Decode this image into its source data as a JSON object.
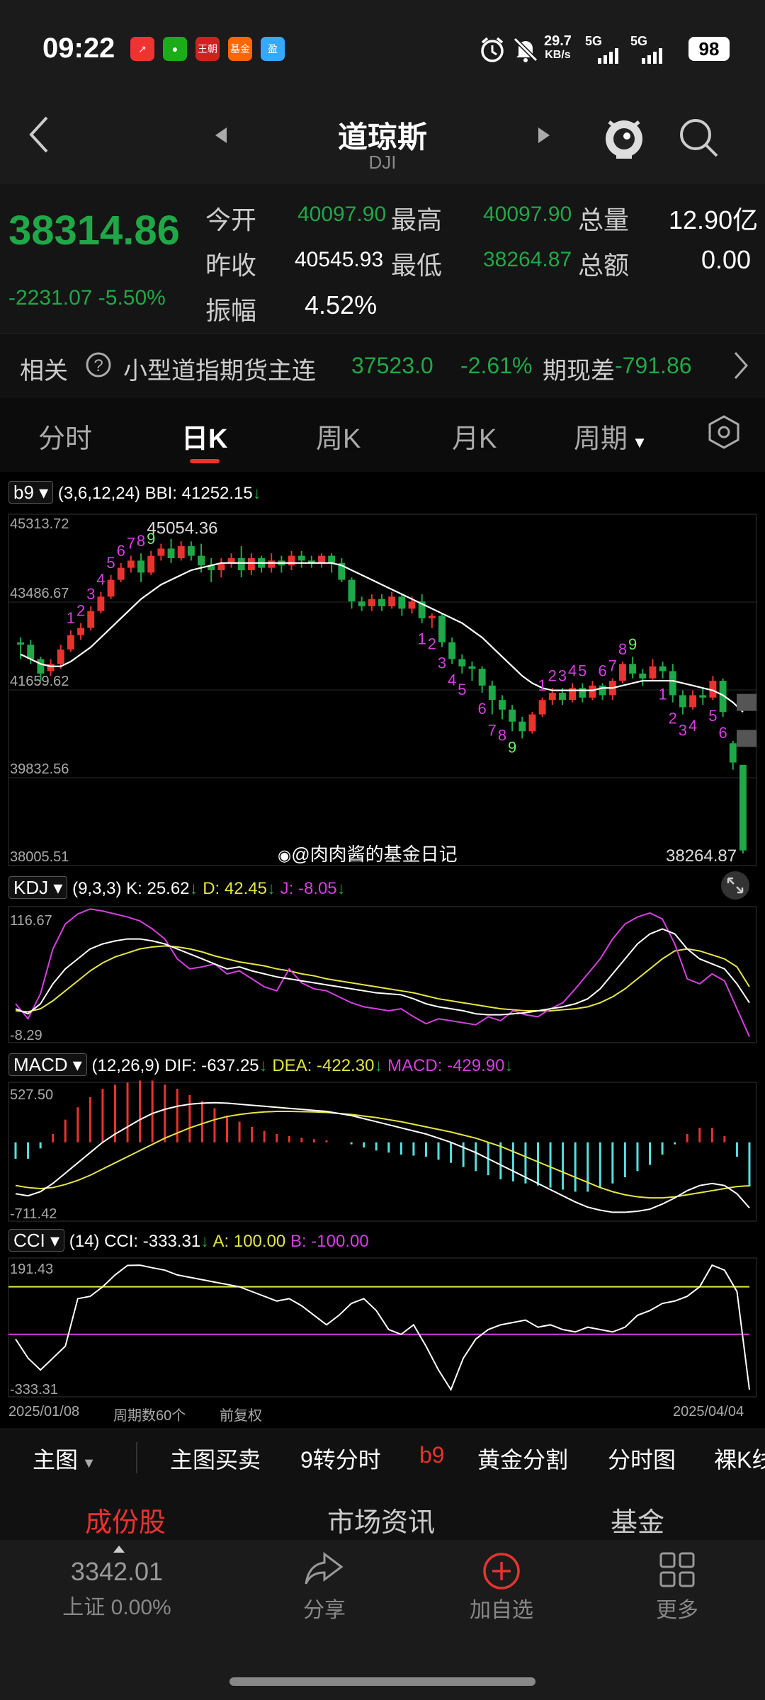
{
  "status_bar": {
    "time": "09:22",
    "net_speed": "29.7",
    "net_unit": "KB/s",
    "sig1": "5G",
    "sig2": "5G",
    "battery": "98",
    "apps": [
      {
        "name": "stock-app-icon",
        "label": "↗",
        "color": "#e33"
      },
      {
        "name": "wechat-icon",
        "label": "●",
        "color": "#1aad19"
      },
      {
        "name": "wangchao-icon",
        "label": "王朝",
        "color": "#c22"
      },
      {
        "name": "fund-app-icon",
        "label": "基金",
        "color": "#f60"
      },
      {
        "name": "eastmoney-icon",
        "label": "盈",
        "color": "#3af"
      }
    ]
  },
  "header": {
    "title": "道琼斯",
    "subtitle": "DJI"
  },
  "quote": {
    "price": "38314.86",
    "change": "-2231.07",
    "change_pct": "-5.50%",
    "open_label": "今开",
    "open": "40097.90",
    "high_label": "最高",
    "high": "40097.90",
    "vol_label": "总量",
    "vol": "12.90亿",
    "prev_label": "昨收",
    "prev": "40545.93",
    "low_label": "最低",
    "low": "38264.87",
    "amt_label": "总额",
    "amt": "0.00",
    "amp_label": "振幅",
    "amp": "4.52%"
  },
  "related": {
    "label": "相关",
    "name": "小型道指期货主连",
    "price": "37523.0",
    "pct": "-2.61%",
    "diff_label": "期现差",
    "diff": "-791.86"
  },
  "tabs": [
    "分时",
    "日K",
    "周K",
    "月K",
    "周期"
  ],
  "active_tab": 1,
  "main_chart": {
    "indicator": "b9",
    "params": "(3,6,12,24)",
    "bbi": "BBI: 41252.15",
    "arrow": "↓",
    "y_labels": [
      "45313.72",
      "43486.67",
      "41659.62",
      "39832.56",
      "38005.51"
    ],
    "high_label": "45054.36",
    "low_label": "38264.87",
    "watermark": "@肉肉酱的基金日记"
  },
  "kdj": {
    "name": "KDJ",
    "params": "(9,3,3)",
    "k": "K: 25.62",
    "d": "D: 42.45",
    "j": "J: -8.05",
    "top": "116.67",
    "bottom": "-8.29"
  },
  "macd": {
    "name": "MACD",
    "params": "(12,26,9)",
    "dif": "DIF: -637.25",
    "dea": "DEA: -422.30",
    "macd": "MACD: -429.90",
    "top": "527.50",
    "bottom": "-711.42"
  },
  "cci": {
    "name": "CCI",
    "params": "(14)",
    "cci": "CCI: -333.31",
    "a": "A: 100.00",
    "b": "B: -100.00",
    "top": "191.43",
    "bottom": "-333.31"
  },
  "footer_axis": {
    "start": "2025/01/08",
    "count": "周期数60个",
    "adj": "前复权",
    "end": "2025/04/04"
  },
  "toolbar": [
    "主图",
    "主图买卖",
    "9转分时",
    "b9",
    "黄金分割",
    "分时图",
    "裸K线"
  ],
  "sections": [
    "成份股",
    "市场资讯",
    "基金"
  ],
  "bottom_nav": {
    "index_value": "3342.01",
    "index_label": "上证 0.00%",
    "share": "分享",
    "add": "加自选",
    "more": "更多"
  },
  "colors": {
    "up": "#e8332f",
    "down": "#1fa847",
    "kdj_k": "#ffffff",
    "kdj_d": "#e5e545",
    "kdj_j": "#d63fe0"
  },
  "chart_data": {
    "type": "candlestick",
    "x_range": [
      "2025/01/08",
      "2025/04/04"
    ],
    "ylim": [
      38005.51,
      45313.72
    ],
    "candles": [
      [
        42650,
        42600,
        42300,
        42750
      ],
      [
        42600,
        42300,
        42200,
        42700
      ],
      [
        42300,
        42000,
        41850,
        42350
      ],
      [
        42050,
        42200,
        41950,
        42300
      ],
      [
        42200,
        42500,
        42100,
        42600
      ],
      [
        42500,
        42800,
        42450,
        42900
      ],
      [
        42800,
        42950,
        42700,
        43050
      ],
      [
        42950,
        43300,
        42900,
        43400
      ],
      [
        43300,
        43600,
        43250,
        43700
      ],
      [
        43600,
        43950,
        43550,
        44050
      ],
      [
        43950,
        44200,
        43900,
        44300
      ],
      [
        44200,
        44350,
        44100,
        44450
      ],
      [
        44350,
        44100,
        43900,
        44500
      ],
      [
        44100,
        44450,
        44050,
        44550
      ],
      [
        44450,
        44600,
        44350,
        44700
      ],
      [
        44600,
        44400,
        44300,
        44800
      ],
      [
        44400,
        44650,
        44350,
        44750
      ],
      [
        44650,
        44450,
        44350,
        44750
      ],
      [
        44450,
        44250,
        44100,
        44700
      ],
      [
        44250,
        44150,
        43900,
        44400
      ],
      [
        44150,
        44300,
        44000,
        44400
      ],
      [
        44300,
        44400,
        44200,
        44500
      ],
      [
        44400,
        44150,
        44000,
        44650
      ],
      [
        44150,
        44400,
        44050,
        44500
      ],
      [
        44400,
        44200,
        44100,
        44450
      ],
      [
        44200,
        44350,
        44100,
        44500
      ],
      [
        44350,
        44250,
        44100,
        44450
      ],
      [
        44250,
        44450,
        44150,
        44550
      ],
      [
        44450,
        44350,
        44200,
        44550
      ],
      [
        44350,
        44300,
        44200,
        44450
      ],
      [
        44300,
        44450,
        44200,
        44500
      ],
      [
        44450,
        44300,
        44100,
        44500
      ],
      [
        44300,
        43950,
        43900,
        44400
      ],
      [
        43950,
        43500,
        43350,
        44000
      ],
      [
        43500,
        43400,
        43300,
        43600
      ],
      [
        43400,
        43550,
        43300,
        43650
      ],
      [
        43550,
        43400,
        43300,
        43650
      ],
      [
        43400,
        43600,
        43350,
        43700
      ],
      [
        43600,
        43350,
        43200,
        43650
      ],
      [
        43350,
        43500,
        43250,
        43600
      ],
      [
        43500,
        43150,
        43050,
        43650
      ],
      [
        43150,
        43200,
        42950,
        43250
      ],
      [
        43200,
        42650,
        42550,
        43250
      ],
      [
        42650,
        42300,
        42200,
        42750
      ],
      [
        42300,
        42150,
        42000,
        42400
      ],
      [
        42150,
        42100,
        41850,
        42250
      ],
      [
        42100,
        41750,
        41600,
        42150
      ],
      [
        41750,
        41450,
        41150,
        41850
      ],
      [
        41450,
        41250,
        41050,
        41550
      ],
      [
        41250,
        41000,
        40800,
        41350
      ],
      [
        41000,
        40800,
        40650,
        41100
      ],
      [
        40800,
        41150,
        40750,
        41200
      ],
      [
        41150,
        41450,
        41100,
        41500
      ],
      [
        41450,
        41600,
        41350,
        41700
      ],
      [
        41600,
        41450,
        41350,
        41700
      ],
      [
        41450,
        41700,
        41400,
        41800
      ],
      [
        41700,
        41500,
        41400,
        41800
      ],
      [
        41500,
        41750,
        41450,
        41850
      ],
      [
        41750,
        41550,
        41450,
        41800
      ],
      [
        41550,
        41850,
        41450,
        41900
      ],
      [
        41850,
        42200,
        41800,
        42250
      ],
      [
        42200,
        42000,
        41900,
        42350
      ],
      [
        42000,
        41900,
        41750,
        42100
      ],
      [
        41900,
        42150,
        41850,
        42300
      ],
      [
        42150,
        42050,
        41900,
        42250
      ],
      [
        42050,
        41550,
        41400,
        42200
      ],
      [
        41550,
        41300,
        41150,
        41650
      ],
      [
        41300,
        41550,
        41250,
        41650
      ],
      [
        41550,
        41500,
        41350,
        41700
      ],
      [
        41500,
        41850,
        41450,
        41950
      ],
      [
        41850,
        41200,
        41100,
        41900
      ],
      [
        40550,
        40150,
        40000,
        40600
      ],
      [
        40100,
        38320,
        38260,
        40100
      ]
    ],
    "bbi_line": [
      42400,
      42300,
      42200,
      42150,
      42150,
      42250,
      42400,
      42550,
      42750,
      42950,
      43150,
      43350,
      43550,
      43700,
      43850,
      43950,
      44050,
      44150,
      44200,
      44250,
      44300,
      44300,
      44300,
      44300,
      44300,
      44300,
      44300,
      44300,
      44300,
      44300,
      44300,
      44300,
      44250,
      44150,
      44050,
      43950,
      43850,
      43750,
      43650,
      43550,
      43450,
      43350,
      43250,
      43150,
      43050,
      42900,
      42750,
      42550,
      42350,
      42150,
      41950,
      41800,
      41700,
      41650,
      41650,
      41650,
      41650,
      41650,
      41700,
      41700,
      41750,
      41800,
      41850,
      41850,
      41850,
      41850,
      41800,
      41750,
      41700,
      41650,
      41550,
      41400,
      41200
    ],
    "b9_marks": [
      {
        "label": "1",
        "i": 5,
        "pos": "up"
      },
      {
        "label": "2",
        "i": 6,
        "pos": "up"
      },
      {
        "label": "3",
        "i": 7,
        "pos": "up"
      },
      {
        "label": "4",
        "i": 8,
        "pos": "up"
      },
      {
        "label": "5",
        "i": 9,
        "pos": "up"
      },
      {
        "label": "6",
        "i": 10,
        "pos": "up"
      },
      {
        "label": "7",
        "i": 11,
        "pos": "up"
      },
      {
        "label": "8",
        "i": 12,
        "pos": "up"
      },
      {
        "label": "9",
        "i": 13,
        "pos": "up",
        "green": true
      },
      {
        "label": "1",
        "i": 40,
        "pos": "down"
      },
      {
        "label": "2",
        "i": 41,
        "pos": "down"
      },
      {
        "label": "3",
        "i": 42,
        "pos": "down"
      },
      {
        "label": "4",
        "i": 43,
        "pos": "down"
      },
      {
        "label": "5",
        "i": 44,
        "pos": "down"
      },
      {
        "label": "6",
        "i": 46,
        "pos": "down"
      },
      {
        "label": "7",
        "i": 47,
        "pos": "down"
      },
      {
        "label": "8",
        "i": 48,
        "pos": "down"
      },
      {
        "label": "9",
        "i": 49,
        "pos": "down",
        "green": true
      },
      {
        "label": "1",
        "i": 52,
        "pos": "up"
      },
      {
        "label": "2",
        "i": 53,
        "pos": "up"
      },
      {
        "label": "3",
        "i": 54,
        "pos": "up"
      },
      {
        "label": "4",
        "i": 55,
        "pos": "up"
      },
      {
        "label": "5",
        "i": 56,
        "pos": "up"
      },
      {
        "label": "6",
        "i": 58,
        "pos": "up"
      },
      {
        "label": "7",
        "i": 59,
        "pos": "up"
      },
      {
        "label": "8",
        "i": 60,
        "pos": "up"
      },
      {
        "label": "9",
        "i": 61,
        "pos": "up",
        "green": true
      },
      {
        "label": "1",
        "i": 64,
        "pos": "down"
      },
      {
        "label": "2",
        "i": 65,
        "pos": "down"
      },
      {
        "label": "3",
        "i": 66,
        "pos": "down"
      },
      {
        "label": "4",
        "i": 67,
        "pos": "down"
      },
      {
        "label": "5",
        "i": 69,
        "pos": "down"
      },
      {
        "label": "6",
        "i": 70,
        "pos": "down"
      }
    ],
    "kdj_k": [
      20,
      15,
      25,
      45,
      60,
      70,
      80,
      85,
      88,
      90,
      90,
      88,
      85,
      80,
      75,
      70,
      65,
      60,
      62,
      58,
      55,
      52,
      50,
      48,
      46,
      44,
      42,
      40,
      38,
      36,
      35,
      34,
      30,
      25,
      22,
      20,
      18,
      15,
      14,
      14,
      15,
      16,
      18,
      20,
      22,
      25,
      30,
      40,
      55,
      70,
      85,
      95,
      100,
      95,
      80,
      70,
      65,
      60,
      45,
      26
    ],
    "kdj_d": [
      18,
      17,
      20,
      28,
      38,
      48,
      58,
      66,
      72,
      76,
      80,
      82,
      83,
      82,
      80,
      77,
      73,
      70,
      67,
      65,
      63,
      60,
      58,
      55,
      53,
      50,
      48,
      46,
      44,
      42,
      40,
      38,
      36,
      33,
      30,
      28,
      26,
      24,
      22,
      20,
      19,
      18,
      18,
      18,
      19,
      20,
      22,
      26,
      32,
      40,
      50,
      60,
      70,
      78,
      80,
      78,
      74,
      70,
      62,
      42
    ],
    "kdj_j": [
      25,
      10,
      35,
      80,
      105,
      115,
      120,
      118,
      115,
      112,
      108,
      100,
      90,
      70,
      60,
      62,
      65,
      55,
      58,
      50,
      42,
      38,
      60,
      46,
      40,
      38,
      32,
      26,
      22,
      20,
      18,
      20,
      12,
      5,
      10,
      8,
      6,
      4,
      12,
      8,
      18,
      14,
      12,
      20,
      26,
      40,
      55,
      70,
      90,
      105,
      112,
      116,
      110,
      85,
      50,
      45,
      55,
      48,
      20,
      -8
    ],
    "macd_dif": [
      -500,
      -520,
      -480,
      -400,
      -300,
      -200,
      -100,
      0,
      80,
      150,
      220,
      280,
      320,
      350,
      370,
      380,
      385,
      380,
      370,
      360,
      350,
      340,
      330,
      320,
      310,
      300,
      280,
      260,
      230,
      200,
      170,
      140,
      110,
      80,
      40,
      0,
      -50,
      -100,
      -160,
      -220,
      -280,
      -340,
      -400,
      -460,
      -520,
      -580,
      -630,
      -660,
      -680,
      -680,
      -670,
      -650,
      -600,
      -540,
      -470,
      -420,
      -400,
      -420,
      -500,
      -637
    ],
    "macd_dea": [
      -420,
      -440,
      -450,
      -440,
      -410,
      -370,
      -320,
      -260,
      -200,
      -140,
      -80,
      -20,
      40,
      90,
      140,
      180,
      220,
      250,
      270,
      285,
      295,
      300,
      300,
      298,
      295,
      290,
      280,
      270,
      255,
      240,
      220,
      200,
      175,
      150,
      125,
      100,
      70,
      40,
      0,
      -40,
      -90,
      -140,
      -190,
      -240,
      -290,
      -340,
      -390,
      -440,
      -480,
      -510,
      -530,
      -540,
      -540,
      -530,
      -510,
      -490,
      -470,
      -450,
      -430,
      -422
    ],
    "cci": [
      -120,
      -200,
      -250,
      -200,
      -150,
      50,
      60,
      100,
      150,
      190,
      191,
      180,
      170,
      150,
      140,
      130,
      120,
      110,
      100,
      80,
      60,
      40,
      50,
      20,
      -20,
      -60,
      -20,
      30,
      50,
      0,
      -80,
      -100,
      -60,
      -150,
      -250,
      -333,
      -200,
      -120,
      -80,
      -60,
      -50,
      -40,
      -70,
      -60,
      -80,
      -90,
      -70,
      -80,
      -90,
      -70,
      -20,
      0,
      30,
      40,
      60,
      100,
      191,
      170,
      80,
      -333
    ],
    "cci_a": 100,
    "cci_b": -100
  }
}
